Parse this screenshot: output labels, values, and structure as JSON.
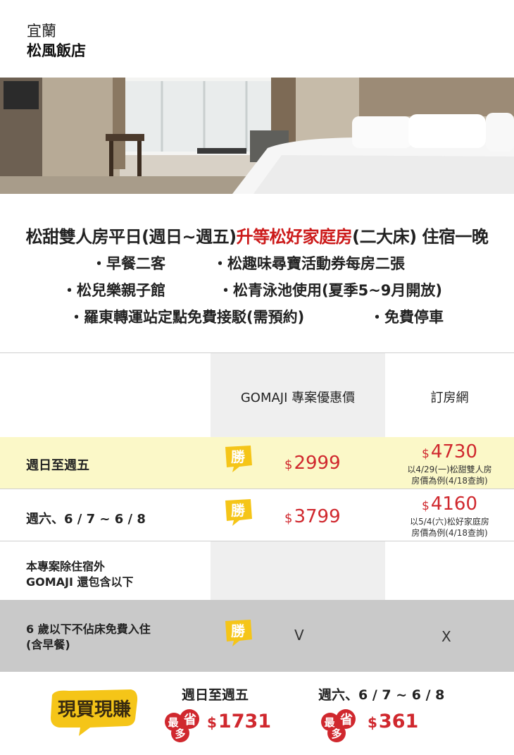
{
  "header": {
    "region": "宜蘭",
    "hotel_name": "松風飯店"
  },
  "photo": {
    "icon": "hotel-room-photo"
  },
  "offer": {
    "headline_part1": "松甜雙人房平日(週日~週五)",
    "headline_upgrade": "升等松好家庭房",
    "headline_part2": "(二大床)  住宿一晚",
    "features_row1": [
      "・早餐二客",
      "・松趣味尋寶活動券每房二張"
    ],
    "features_row2": [
      "・松兒樂親子館",
      "・松青泳池使用(夏季5~9月開放)"
    ],
    "features_row3": [
      "・羅東轉運站定點免費接駁(需預約)",
      "・免費停車"
    ]
  },
  "table": {
    "col_gomaji": "GOMAJI 專案優惠價",
    "col_booking": "訂房網",
    "win_badge_text": "勝",
    "currency": "$",
    "rows": [
      {
        "label": "週日至週五",
        "gomaji_price": "2999",
        "booking_price": "4730",
        "booking_note1": "以4/29(一)松甜雙人房",
        "booking_note2": "房價為例(4/18查詢)"
      },
      {
        "label": "週六、6 / 7 ~ 6 / 8",
        "gomaji_price": "3799",
        "booking_price": "4160",
        "booking_note1": "以5/4(六)松好家庭房",
        "booking_note2": "房價為例(4/18查詢)"
      }
    ],
    "extra_label_line1": "本專案除住宿外",
    "extra_label_line2": "GOMAJI 還包含以下",
    "child_label_line1": "6 歲以下不佔床免費入住",
    "child_label_line2": "(含早餐)",
    "child_gomaji": "V",
    "child_booking": "X"
  },
  "footer": {
    "slogan": "現買現賺",
    "save_badge_chars": [
      "最",
      "省",
      "多"
    ],
    "weekday_title": "週日至週五",
    "weekday_save": "1731",
    "weekend_title": "週六、6 / 7 ~ 6 / 8",
    "weekend_save": "361"
  },
  "colors": {
    "accent_red": "#d0282e",
    "highlight_row": "#fbf8c8",
    "grey_row": "#c9c9c9",
    "badge_yellow": "#f5c518"
  }
}
